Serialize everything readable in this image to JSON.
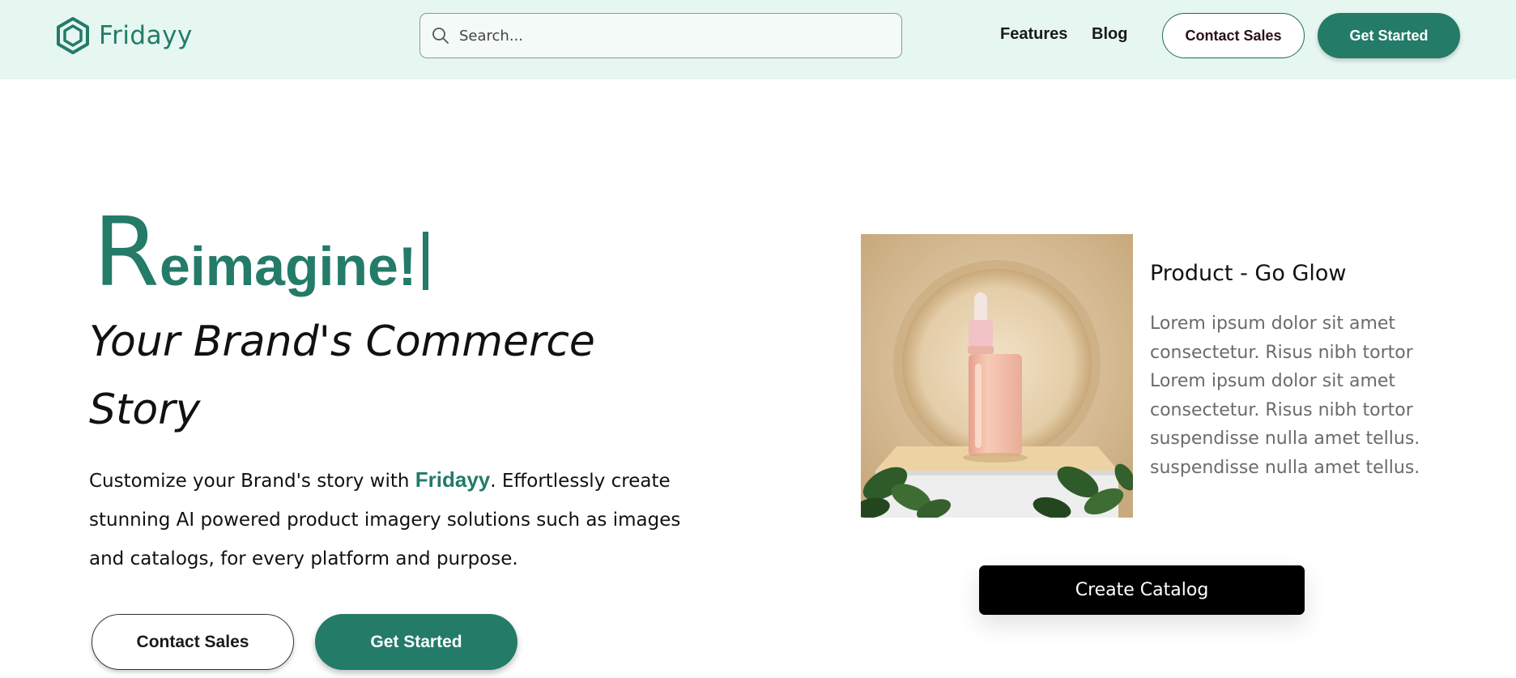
{
  "header": {
    "brand_name": "Fridayy",
    "search_placeholder": "Search...",
    "nav": {
      "features": "Features",
      "blog": "Blog"
    },
    "contact_sales": "Contact Sales",
    "get_started": "Get Started"
  },
  "hero": {
    "title_initial": "R",
    "title_rest": "eimagine!",
    "subtitle": "Your Brand's Commerce Story",
    "desc_before": "Customize your Brand's story with ",
    "desc_brand": "Fridayy",
    "desc_after": ".  Effortlessly create stunning AI powered product imagery solutions such as images and catalogs, for every platform and purpose.",
    "contact_sales": "Contact Sales",
    "get_started": "Get Started"
  },
  "product": {
    "name": "Product - Go Glow",
    "description": "Lorem ipsum dolor sit amet consectetur. Risus nibh tortor  Lorem ipsum dolor sit amet consectetur. Risus nibh tortor suspendisse nulla amet tellus. suspendisse nulla amet tellus.",
    "create_catalog": "Create Catalog"
  },
  "colors": {
    "brand_green": "#237b68",
    "header_bg": "#e6f6f1",
    "catalog_button": "#000000"
  },
  "icons": {
    "logo": "hexagon-ring-logo-icon",
    "search": "search-icon"
  }
}
